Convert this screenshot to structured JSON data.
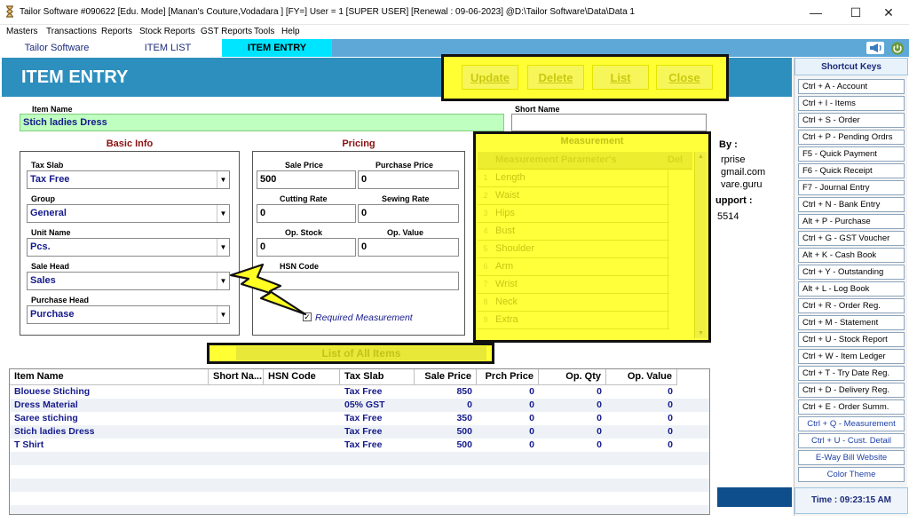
{
  "window": {
    "title": "Tailor Software #090622  [Edu. Mode] [Manan's Couture,Vodadara ] [FY=] User =  1 [SUPER USER]  [Renewal : 09-06-2023] @D:\\Tailor Software\\Data\\Data 1",
    "minimize": "—",
    "maximize": "☐",
    "close": "✕"
  },
  "menu": [
    "Masters",
    "Transactions",
    "Reports",
    "Stock Reports",
    "GST Reports",
    "Tools",
    "Help"
  ],
  "tabs": [
    {
      "label": "Tailor Software"
    },
    {
      "label": "ITEM LIST"
    },
    {
      "label": "ITEM ENTRY"
    }
  ],
  "header": {
    "title": "ITEM ENTRY"
  },
  "actions": {
    "update": "Update",
    "delete": "Delete",
    "list": "List",
    "close": "Close"
  },
  "item": {
    "name_label": "Item Name",
    "name_value": "Stich ladies Dress",
    "short_name_label": "Short Name",
    "short_name_value": ""
  },
  "basic_info": {
    "title": "Basic Info",
    "tax_slab_label": "Tax Slab",
    "tax_slab_value": "Tax Free",
    "group_label": "Group",
    "group_value": "General",
    "unit_label": "Unit Name",
    "unit_value": "Pcs.",
    "sale_head_label": "Sale Head",
    "sale_head_value": "Sales",
    "purchase_head_label": "Purchase Head",
    "purchase_head_value": "Purchase"
  },
  "pricing": {
    "title": "Pricing",
    "sale_price_label": "Sale Price",
    "sale_price_value": "500",
    "purchase_price_label": "Purchase Price",
    "purchase_price_value": "0",
    "cutting_rate_label": "Cutting Rate",
    "cutting_rate_value": "0",
    "sewing_rate_label": "Sewing Rate",
    "sewing_rate_value": "0",
    "op_stock_label": "Op. Stock",
    "op_stock_value": "0",
    "op_value_label": "Op. Value",
    "op_value_value": "0",
    "hsn_label": "HSN Code",
    "hsn_value": "",
    "required_measurement_label": "Required Measurement",
    "required_measurement_checked": true
  },
  "measurement": {
    "title": "Measurement",
    "col_param": "Measurement Parameter's",
    "col_del": "Del",
    "rows": [
      {
        "n": "1",
        "name": "Length"
      },
      {
        "n": "2",
        "name": "Waist"
      },
      {
        "n": "3",
        "name": "Hips"
      },
      {
        "n": "4",
        "name": "Bust"
      },
      {
        "n": "5",
        "name": "Shoulder"
      },
      {
        "n": "6",
        "name": "Arm"
      },
      {
        "n": "7",
        "name": "Wrist"
      },
      {
        "n": "8",
        "name": "Neck"
      },
      {
        "n": "9",
        "name": "Extra"
      }
    ]
  },
  "info_partial": [
    "By :",
    "rprise",
    "gmail.com",
    "vare.guru",
    "upport :",
    "5514"
  ],
  "list_title": "List of All Items",
  "grid": {
    "headers": [
      "Item Name",
      "Short Na...",
      "HSN Code",
      "Tax Slab",
      "Sale Price",
      "Prch Price",
      "Op. Qty",
      "Op. Value"
    ],
    "rows": [
      [
        "Blouese Stiching",
        "",
        "",
        "Tax Free",
        "850",
        "0",
        "0",
        "0"
      ],
      [
        "Dress Material",
        "",
        "",
        "05% GST",
        "0",
        "0",
        "0",
        "0"
      ],
      [
        "Saree stiching",
        "",
        "",
        "Tax Free",
        "350",
        "0",
        "0",
        "0"
      ],
      [
        "Stich ladies Dress",
        "",
        "",
        "Tax Free",
        "500",
        "0",
        "0",
        "0"
      ],
      [
        "T Shirt",
        "",
        "",
        "Tax Free",
        "500",
        "0",
        "0",
        "0"
      ]
    ]
  },
  "shortcuts": {
    "title": "Shortcut Keys",
    "items": [
      "Ctrl + A - Account",
      "Ctrl + I - Items",
      "Ctrl + S - Order",
      "Ctrl + P - Pending Ordrs",
      "F5 - Quick Payment",
      "F6 - Quick Receipt",
      "F7 - Journal Entry",
      "Ctrl + N - Bank Entry",
      "Alt + P - Purchase",
      "Ctrl + G - GST Voucher",
      "Alt + K - Cash Book",
      "Ctrl + Y  -  Outstanding",
      "Alt + L  -  Log Book",
      "Ctrl + R - Order Reg.",
      "Ctrl + M - Statement",
      "Ctrl + U - Stock Report",
      "Ctrl + W - Item Ledger",
      "Ctrl + T - Try Date Reg.",
      "Ctrl + D - Delivery Reg.",
      "Ctrl + E - Order Summ.",
      "Ctrl + Q - Measurement",
      "Ctrl + U - Cust. Detail",
      "E-Way Bill Website",
      "Color Theme"
    ],
    "time": "Time : 09:23:15 AM"
  }
}
